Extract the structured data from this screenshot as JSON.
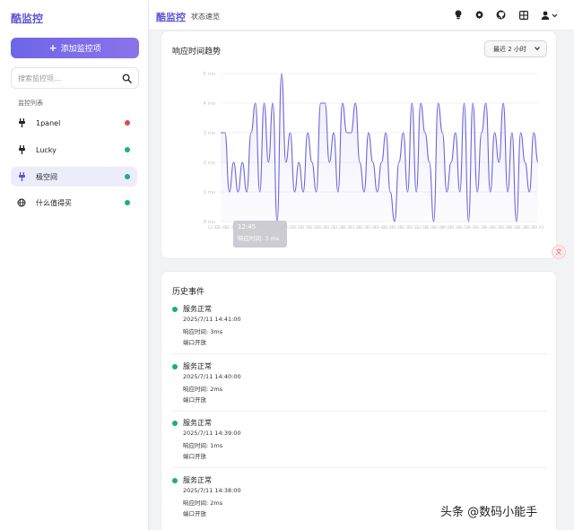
{
  "sidebar": {
    "brand": "酷监控",
    "add_button": "添加监控项",
    "search_placeholder": "搜索监控项...",
    "list_title": "监控列表",
    "items": [
      {
        "label": "1panel",
        "status_color": "#e0484d",
        "icon": "plug-icon",
        "active": false
      },
      {
        "label": "Lucky",
        "status_color": "#1bb07a",
        "icon": "plug-icon",
        "active": false
      },
      {
        "label": "极空间",
        "status_color": "#1bb07a",
        "icon": "plug-icon",
        "active": true
      },
      {
        "label": "什么值得买",
        "status_color": "#1bb07a",
        "icon": "globe-icon",
        "active": false
      }
    ]
  },
  "topbar": {
    "brand": "酷监控",
    "subtitle": "状态速览",
    "icons": [
      "lightbulb-icon",
      "gear-icon",
      "github-icon",
      "grid-icon",
      "user-icon"
    ]
  },
  "chart": {
    "title": "响应时间趋势",
    "range_select": "最近 2 小时",
    "tooltip_time": "12:45",
    "tooltip_value": "响应时间: 3 ms"
  },
  "chart_data": {
    "type": "line",
    "ylabel": "",
    "ylim": [
      0,
      5
    ],
    "yticks": [
      "0 ms",
      "1 ms",
      "2 ms",
      "3 ms",
      "4 ms",
      "5 ms"
    ],
    "x": [
      "12:43",
      "12:46",
      "12:49",
      "12:52",
      "12:55",
      "12:58",
      "13:01",
      "13:04",
      "13:07",
      "13:10",
      "13:13",
      "13:16",
      "13:19",
      "13:22",
      "13:25",
      "13:28",
      "13:31",
      "13:34",
      "13:37",
      "13:40",
      "13:43",
      "13:46",
      "13:49",
      "13:52",
      "13:55",
      "13:58",
      "14:01",
      "14:04",
      "14:07",
      "14:10",
      "14:13",
      "14:16",
      "14:19",
      "14:22",
      "14:25",
      "14:28",
      "14:31",
      "14:34",
      "14:37",
      "14:40"
    ],
    "series": [
      {
        "values": [
          3,
          3,
          1,
          2,
          1,
          2,
          1,
          3,
          4,
          1,
          4,
          2,
          4,
          0,
          5,
          2,
          3,
          1,
          2,
          1,
          3,
          2,
          1,
          4,
          4,
          2,
          3,
          1,
          4,
          3,
          3,
          4,
          2,
          1,
          3,
          2,
          1,
          2,
          3,
          1,
          0,
          2,
          3,
          1,
          4,
          1,
          4,
          3,
          2,
          0,
          4,
          3,
          1,
          2,
          3,
          1,
          4,
          0,
          4,
          1,
          3,
          4,
          1,
          3,
          2,
          4,
          1,
          3,
          0,
          3,
          2,
          1,
          3,
          2
        ]
      }
    ]
  },
  "events": {
    "title": "历史事件",
    "items": [
      {
        "status": "服务正常",
        "time": "2025/7/11 14:41:00",
        "response": "响应时间: 3ms",
        "port": "端口开放"
      },
      {
        "status": "服务正常",
        "time": "2025/7/11 14:40:00",
        "response": "响应时间: 2ms",
        "port": "端口开放"
      },
      {
        "status": "服务正常",
        "time": "2025/7/11 14:39:00",
        "response": "响应时间: 1ms",
        "port": "端口开放"
      },
      {
        "status": "服务正常",
        "time": "2025/7/11 14:38:00",
        "response": "响应时间: 2ms",
        "port": "端口开放"
      }
    ]
  },
  "colors": {
    "accent": "#5b56d6",
    "line": "#6b66dd",
    "ok": "#1bb07a",
    "down": "#e0484d"
  },
  "watermark": "头条 @数码小能手"
}
